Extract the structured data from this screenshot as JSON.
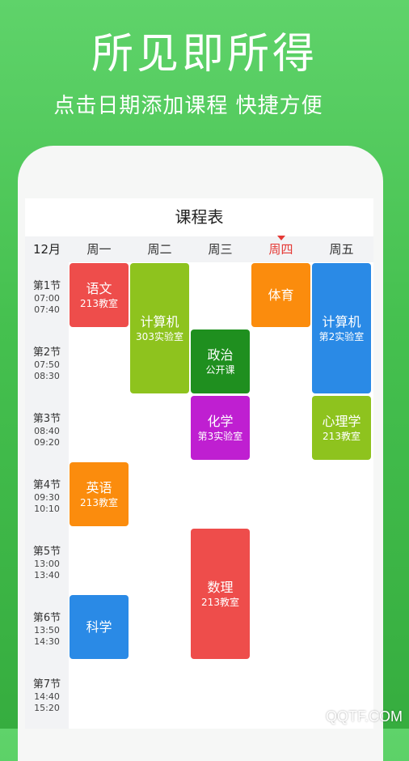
{
  "header": {
    "headline": "所见即所得",
    "subline": "点击日期添加课程  快捷方便"
  },
  "app": {
    "title": "课程表",
    "month": "12月",
    "days": [
      "周一",
      "周二",
      "周三",
      "周四",
      "周五"
    ],
    "today": "周四",
    "periods": [
      {
        "name": "第1节",
        "start": "07:00",
        "end": "07:40"
      },
      {
        "name": "第2节",
        "start": "07:50",
        "end": "08:30"
      },
      {
        "name": "第3节",
        "start": "08:40",
        "end": "09:20"
      },
      {
        "name": "第4节",
        "start": "09:30",
        "end": "10:10"
      },
      {
        "name": "第5节",
        "start": "13:00",
        "end": "13:40"
      },
      {
        "name": "第6节",
        "start": "13:50",
        "end": "14:30"
      },
      {
        "name": "第7节",
        "start": "14:40",
        "end": "15:20"
      }
    ],
    "courses": [
      {
        "name": "语文",
        "room": "213教室",
        "day": 1,
        "period": 1,
        "span": 1,
        "color": "#ee4d4b"
      },
      {
        "name": "计算机",
        "room": "303实验室",
        "day": 2,
        "period": 1,
        "span": 2,
        "color": "#8ec31e"
      },
      {
        "name": "体育",
        "room": "",
        "day": 4,
        "period": 1,
        "span": 1,
        "color": "#fb8c0d"
      },
      {
        "name": "计算机",
        "room": "第2实验室",
        "day": 5,
        "period": 1,
        "span": 2,
        "color": "#2a8ae6"
      },
      {
        "name": "政治",
        "room": "公开课",
        "day": 3,
        "period": 2,
        "span": 1,
        "color": "#1f8f1f"
      },
      {
        "name": "化学",
        "room": "第3实验室",
        "day": 3,
        "period": 3,
        "span": 1,
        "color": "#bf1fd1"
      },
      {
        "name": "心理学",
        "room": "213教室",
        "day": 5,
        "period": 3,
        "span": 1,
        "color": "#8ec31e"
      },
      {
        "name": "英语",
        "room": "213教室",
        "day": 1,
        "period": 4,
        "span": 1,
        "color": "#fb8c0d"
      },
      {
        "name": "数理",
        "room": "213教室",
        "day": 3,
        "period": 5,
        "span": 2,
        "color": "#ee4d4b"
      },
      {
        "name": "科学",
        "room": "",
        "day": 1,
        "period": 6,
        "span": 1,
        "color": "#2a8ae6"
      }
    ]
  },
  "watermark": "QQTF.COM"
}
